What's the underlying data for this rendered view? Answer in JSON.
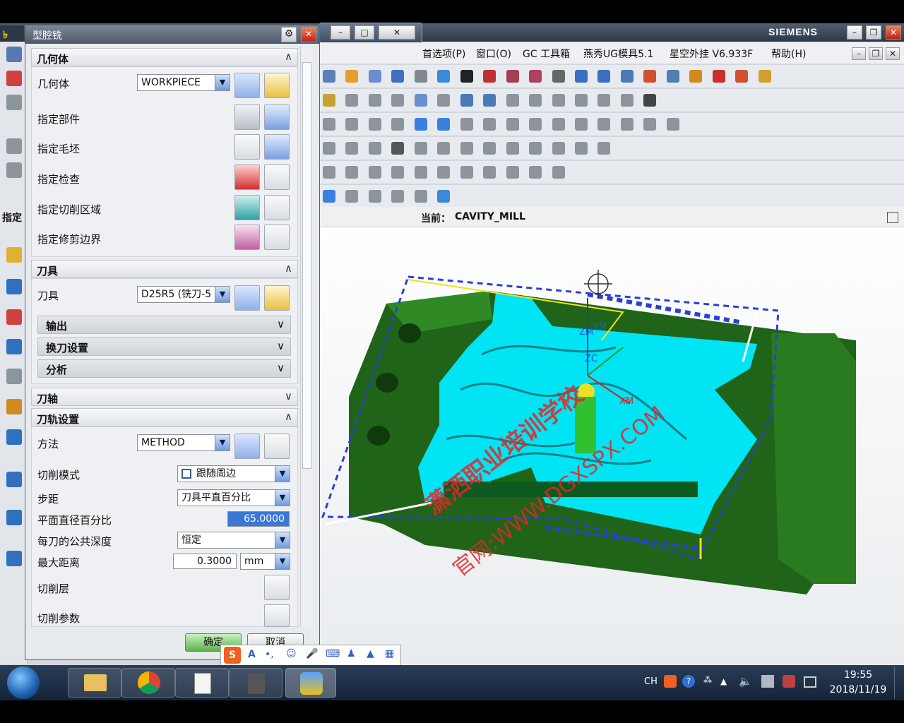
{
  "app": {
    "brand": "SIEMENS",
    "menus": [
      "首选项(P)",
      "窗口(O)",
      "GC 工具箱",
      "燕秀UG模具5.1",
      "星空外挂 V6.933F",
      "帮助(H)"
    ],
    "menu_partial": "首选项(P)",
    "current_label": "当前：",
    "current_operation": "CAVITY_MILL",
    "left_strip_label": "指定"
  },
  "dialog": {
    "title": "型腔铣",
    "geometry_section": {
      "title": "几何体",
      "geometry_label": "几何体",
      "geometry_value": "WORKPIECE",
      "rows": [
        "指定部件",
        "指定毛坯",
        "指定检查",
        "指定切削区域",
        "指定修剪边界"
      ]
    },
    "tool_section": {
      "title": "刀具",
      "tool_label": "刀具",
      "tool_value": "D25R5 (铣刀-5",
      "subsections": [
        "输出",
        "换刀设置",
        "分析"
      ]
    },
    "axis_section": {
      "title": "刀轴"
    },
    "path_section": {
      "title": "刀轨设置",
      "method_label": "方法",
      "method_value": "METHOD",
      "cut_pattern_label": "切削模式",
      "cut_pattern_value": "跟随周边",
      "stepover_label": "步距",
      "stepover_value": "刀具平直百分比",
      "percent_label": "平面直径百分比",
      "percent_value": "65.0000",
      "depth_label": "每刀的公共深度",
      "depth_value": "恒定",
      "maxdist_label": "最大距离",
      "maxdist_value": "0.3000",
      "maxdist_unit": "mm",
      "levels_label": "切削层",
      "params_label": "切削参数"
    },
    "ok": "确定",
    "cancel": "取消"
  },
  "viewport": {
    "watermark_line1": "潇洒职业培训学校",
    "watermark_line2": "官网:WWW.DGXSPX.COM",
    "axis_zm": "ZM",
    "axis_ym": "YM",
    "axis_xm": "XM",
    "axis_zc": "ZC"
  },
  "taskbar": {
    "lang": "CH",
    "time": "19:55",
    "date": "2018/11/19"
  },
  "colors": {
    "part_green": "#1f6418",
    "toolpath_cyan": "#00e4f4",
    "boundary_blue": "#2b3fd8",
    "accent_yellow": "#f2e218"
  }
}
